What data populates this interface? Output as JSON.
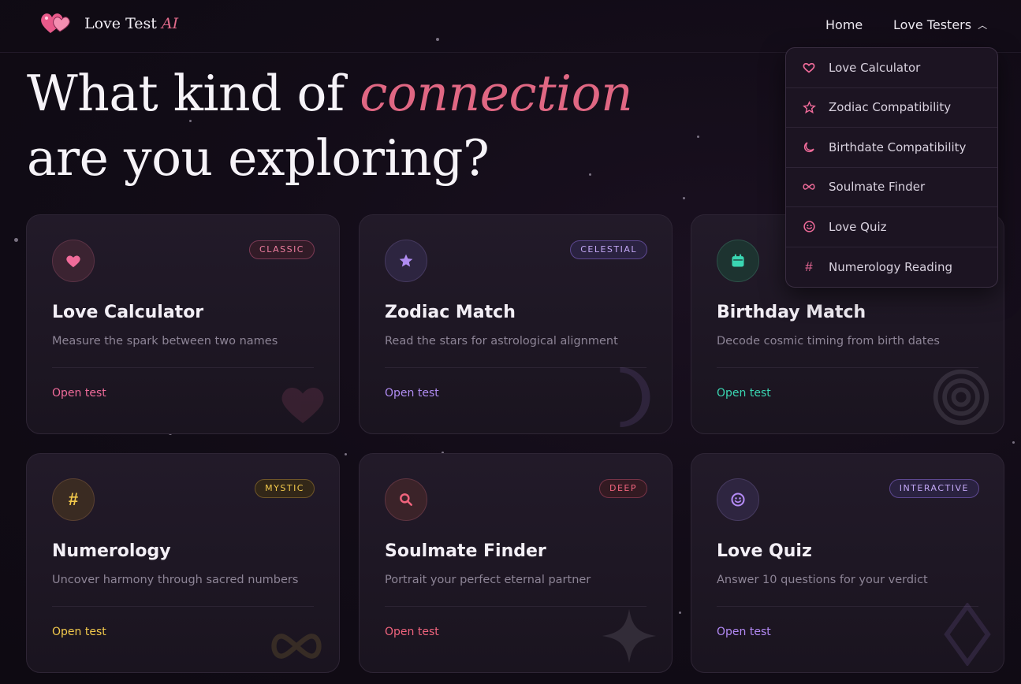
{
  "brand": {
    "name": "Love Test",
    "suffix": "AI"
  },
  "nav": {
    "home": "Home",
    "testers": "Love Testers"
  },
  "hero": {
    "line1_prefix": "What kind of",
    "line1_accent": "connection",
    "line2": "are you exploring?"
  },
  "dropdown": [
    {
      "label": "Love Calculator",
      "icon": "heart-icon"
    },
    {
      "label": "Zodiac Compatibility",
      "icon": "star-icon"
    },
    {
      "label": "Birthdate Compatibility",
      "icon": "moon-icon"
    },
    {
      "label": "Soulmate Finder",
      "icon": "infinity-icon"
    },
    {
      "label": "Love Quiz",
      "icon": "smiley-icon"
    },
    {
      "label": "Numerology Reading",
      "icon": "hash-icon"
    }
  ],
  "cards": [
    {
      "title": "Love Calculator",
      "desc": "Measure the spark between two names",
      "badge": "CLASSIC",
      "cta": "Open test",
      "icon": "heart-icon",
      "accent": "#f06b9a"
    },
    {
      "title": "Zodiac Match",
      "desc": "Read the stars for astrological alignment",
      "badge": "CELESTIAL",
      "cta": "Open test",
      "icon": "star-icon",
      "accent": "#b08cf2"
    },
    {
      "title": "Birthday Match",
      "desc": "Decode cosmic timing from birth dates",
      "badge": "",
      "cta": "Open test",
      "icon": "calendar-icon",
      "accent": "#3ad6b2"
    },
    {
      "title": "Numerology",
      "desc": "Uncover harmony through sacred numbers",
      "badge": "MYSTIC",
      "cta": "Open test",
      "icon": "hash-icon",
      "accent": "#f2c94c"
    },
    {
      "title": "Soulmate Finder",
      "desc": "Portrait your perfect eternal partner",
      "badge": "DEEP",
      "cta": "Open test",
      "icon": "search-icon",
      "accent": "#f0647d"
    },
    {
      "title": "Love Quiz",
      "desc": "Answer 10 questions for your verdict",
      "badge": "INTERACTIVE",
      "cta": "Open test",
      "icon": "smiley-icon",
      "accent": "#b38af5"
    }
  ]
}
